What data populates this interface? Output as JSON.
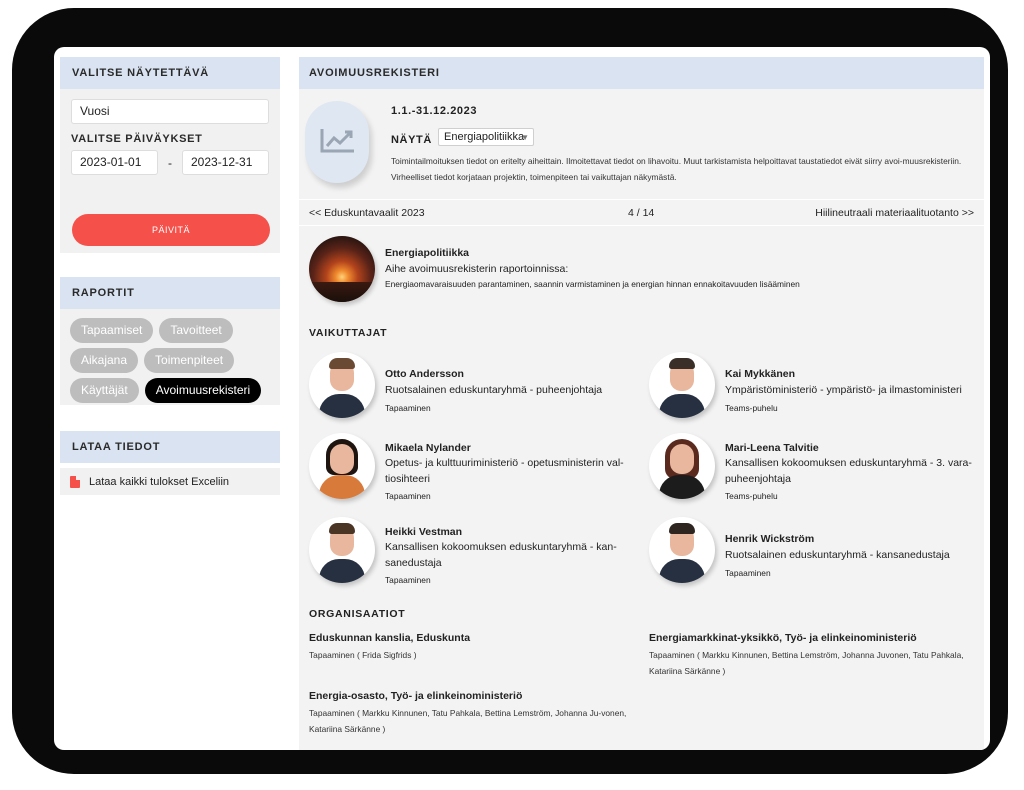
{
  "sidebar": {
    "period_header": "VALITSE NÄYTETTÄVÄ AJANJAKSO",
    "period_select": "Vuosi",
    "dates_label": "VALITSE PÄIVÄYKSET",
    "date_start": "2023-01-01",
    "date_separator": "-",
    "date_end": "2023-12-31",
    "update_button": "PÄIVITÄ",
    "reports_header": "RAPORTIT",
    "reports": [
      {
        "label": "Tapaamiset",
        "active": false
      },
      {
        "label": "Tavoitteet",
        "active": false
      },
      {
        "label": "Aikajana",
        "active": false
      },
      {
        "label": "Toimenpiteet",
        "active": false
      },
      {
        "label": "Käyttäjät",
        "active": false
      },
      {
        "label": "Avoimuusrekisteri",
        "active": true
      }
    ],
    "download_header": "LATAA TIEDOT",
    "download_link": "Lataa kaikki tulokset Exceliin"
  },
  "main": {
    "header": "AVOIMUUSREKISTERI",
    "period": "1.1.-31.12.2023",
    "show_label": "NÄYTÄ",
    "topic_select": "Energiapolitiikka",
    "intro_text": "Toimintailmoituksen tiedot on eritelty aiheittain. Ilmoitettavat tiedot on lihavoitu. Muut tarkistamista helpoittavat taustatiedot eivät siirry avoi-muusrekisteriin. Virheelliset tiedot korjataan projektin, toimenpiteen tai vaikuttajan näkymästä.",
    "pager": {
      "prev": "<< Eduskuntavaalit 2023",
      "count": "4 / 14",
      "next": "Hiilineutraali materiaalituotanto >>"
    },
    "topic": {
      "name": "Energiapolitiikka",
      "subtitle": "Aihe avoimuusrekisterin raportoinnissa:",
      "description": "Energiaomavaraisuuden parantaminen, saannin varmistaminen ja energian hinnan ennakoitavuuden lisääminen"
    },
    "influencers_title": "VAIKUTTAJAT",
    "influencers": [
      {
        "name": "Otto Andersson",
        "role": "Ruotsalainen eduskuntaryhmä - puheenjohtaja",
        "meeting": "Tapaaminen"
      },
      {
        "name": "Kai Mykkänen",
        "role": "Ympäristöministeriö - ympäristö- ja ilmastoministeri",
        "meeting": "Teams-puhelu"
      },
      {
        "name": "Mikaela Nylander",
        "role": "Opetus- ja kulttuuriministeriö - opetusministerin val-tiosihteeri",
        "meeting": "Tapaaminen"
      },
      {
        "name": "Mari-Leena Talvitie",
        "role": "Kansallisen kokoomuksen eduskuntaryhmä - 3. vara-puheenjohtaja",
        "meeting": "Teams-puhelu"
      },
      {
        "name": "Heikki Vestman",
        "role": "Kansallisen kokoomuksen eduskuntaryhmä - kan-sanedustaja",
        "meeting": "Tapaaminen"
      },
      {
        "name": "Henrik Wickström",
        "role": "Ruotsalainen eduskuntaryhmä - kansanedustaja",
        "meeting": "Tapaaminen"
      }
    ],
    "organizations_title": "ORGANISAATIOT",
    "organizations": [
      {
        "name": "Eduskunnan kanslia, Eduskunta",
        "details": "Tapaaminen ( Frida Sigfrids )"
      },
      {
        "name": "Energiamarkkinat-yksikkö, Työ- ja elinkeinoministeriö",
        "details": "Tapaaminen ( Markku Kinnunen, Bettina Lemström, Johanna Juvonen, Tatu Pahkala, Katariina Särkänne )"
      },
      {
        "name": "Energia-osasto, Työ- ja elinkeinoministeriö",
        "details": "Tapaaminen ( Markku Kinnunen, Tatu Pahkala, Bettina Lemström, Johanna Ju-vonen, Katariina Särkänne )"
      }
    ]
  },
  "colors": {
    "header_bg": "#d9e3f1",
    "accent": "#f5504a",
    "panel_bg": "#f1f1f1",
    "chip_bg": "#bdbdbd",
    "chip_active_bg": "#000000"
  },
  "icons": {
    "topic_chart": "chart-trend-icon",
    "download": "file-pdf-icon",
    "dropdown": "caret-down-icon"
  }
}
